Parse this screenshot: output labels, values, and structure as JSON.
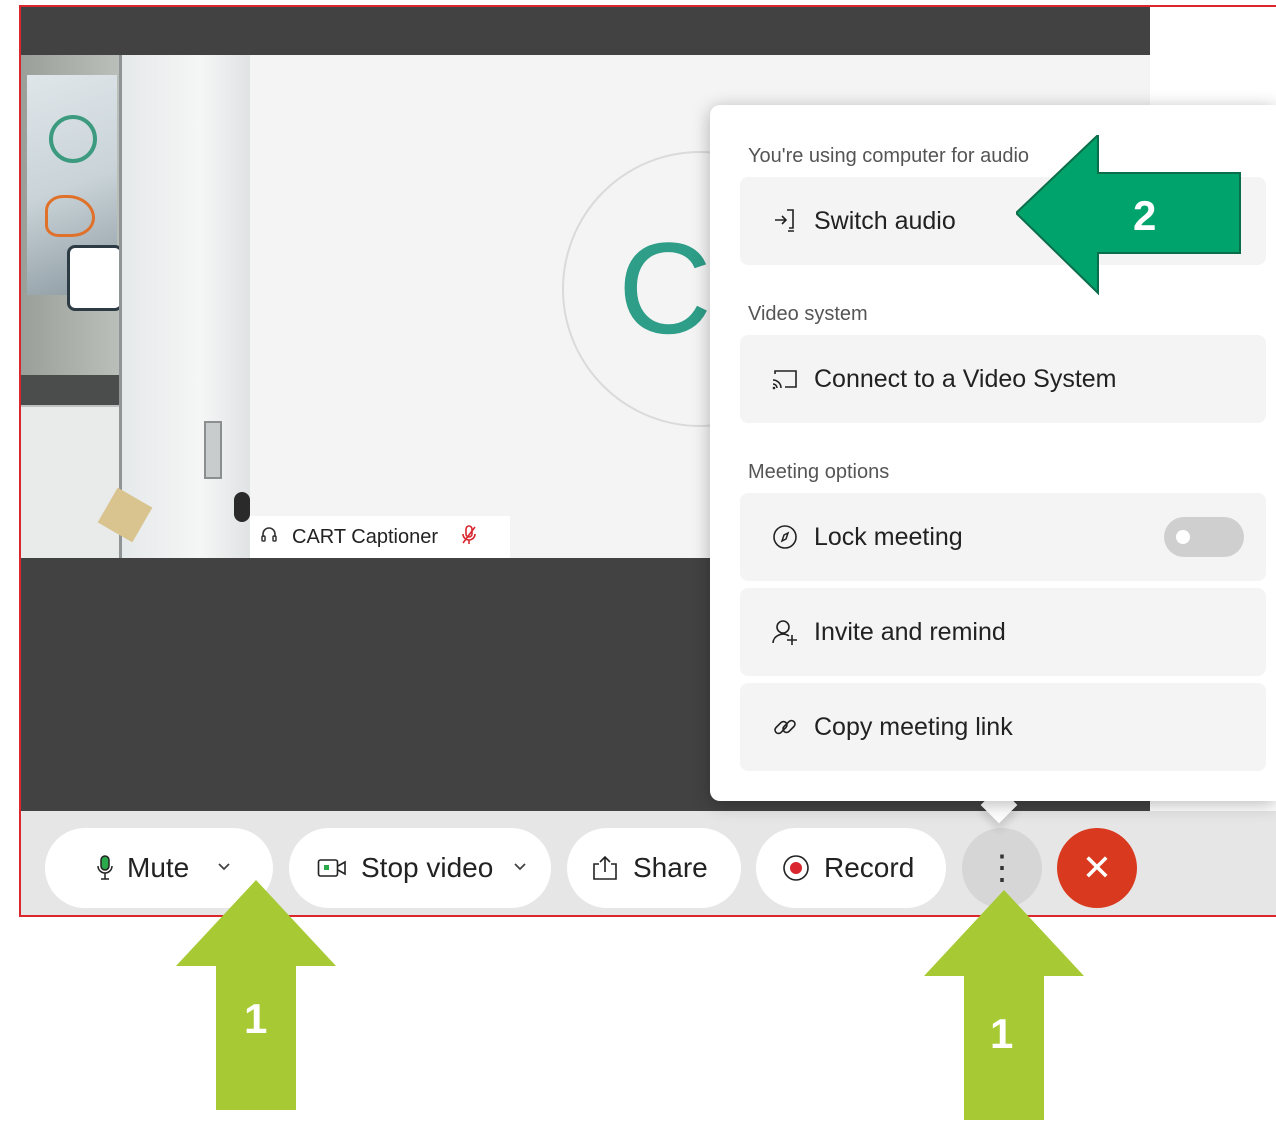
{
  "participant": {
    "name": "CART Captioner",
    "initials": "CC"
  },
  "toolbar": {
    "mute_label": "Mute",
    "stop_video_label": "Stop video",
    "share_label": "Share",
    "record_label": "Record",
    "more_label": "⋮",
    "end_label": "✕"
  },
  "menu": {
    "audio_section": "You're using computer for audio",
    "switch_audio": "Switch audio",
    "video_section": "Video system",
    "connect_video": "Connect to a Video System",
    "options_section": "Meeting options",
    "lock_meeting": "Lock meeting",
    "lock_meeting_on": false,
    "invite_remind": "Invite and remind",
    "copy_link": "Copy meeting link"
  },
  "annotations": {
    "arrow_mute_label": "1",
    "arrow_more_label": "1",
    "arrow_switch_label": "2"
  },
  "colors": {
    "frame_border": "#d9262f",
    "end_button": "#d93a1f",
    "mic_active": "#2aa84a",
    "record_dot": "#d9262f",
    "avatar_initials": "#2e9e88",
    "step1_arrow": "#a6c934",
    "step2_arrow": "#00a36c"
  }
}
